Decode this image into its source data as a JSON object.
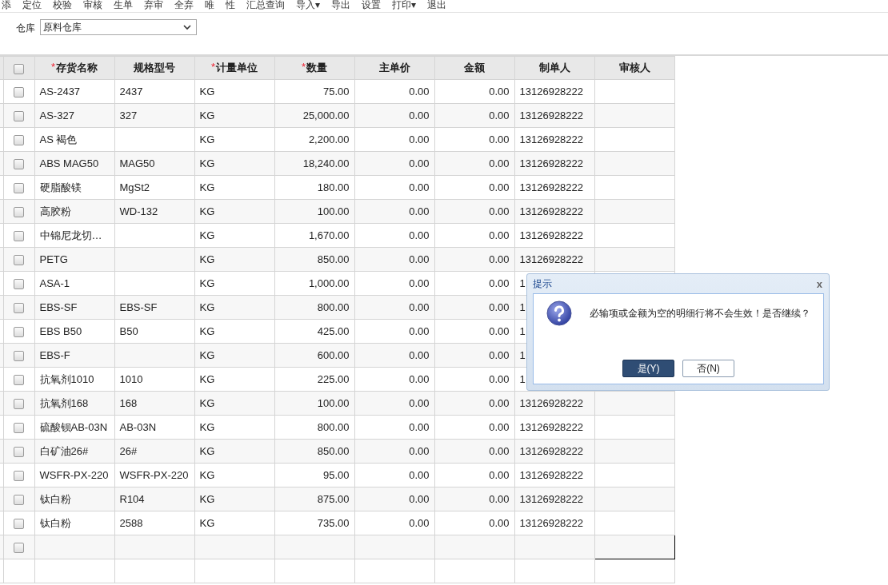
{
  "toolbar": [
    "添",
    "定位",
    "校验",
    "审核",
    "生单",
    "弃审",
    "全弃",
    "唯",
    "性",
    "汇总查询",
    "导入▾",
    "导出",
    "设置",
    "打印▾",
    "退出"
  ],
  "warehouse": {
    "label": "仓库",
    "value": "原料仓库"
  },
  "table": {
    "header_checkbox": {
      "checked": false
    },
    "columns": [
      {
        "label": "存货名称",
        "mark": "*",
        "kind": "text"
      },
      {
        "label": "规格型号",
        "kind": "text"
      },
      {
        "label": "计量单位",
        "mark": "*",
        "kind": "text"
      },
      {
        "label": "数量",
        "mark": "*",
        "kind": "number"
      },
      {
        "label": "主单价",
        "kind": "number"
      },
      {
        "label": "金额",
        "kind": "number"
      },
      {
        "label": "制单人",
        "kind": "text"
      },
      {
        "label": "审核人",
        "kind": "text"
      }
    ],
    "rows": [
      {
        "checked": false,
        "cells": [
          "AS-2437",
          "2437",
          "KG",
          "75.00",
          "0.00",
          "0.00",
          "13126928222",
          ""
        ]
      },
      {
        "checked": false,
        "cells": [
          "AS-327",
          "327",
          "KG",
          "25,000.00",
          "0.00",
          "0.00",
          "13126928222",
          ""
        ]
      },
      {
        "checked": false,
        "cells": [
          "AS 褐色",
          "",
          "KG",
          "2,200.00",
          "0.00",
          "0.00",
          "13126928222",
          ""
        ]
      },
      {
        "checked": false,
        "cells": [
          "ABS MAG50",
          "MAG50",
          "KG",
          "18,240.00",
          "0.00",
          "0.00",
          "13126928222",
          ""
        ]
      },
      {
        "checked": false,
        "cells": [
          "硬脂酸镁",
          "MgSt2",
          "KG",
          "180.00",
          "0.00",
          "0.00",
          "13126928222",
          ""
        ]
      },
      {
        "checked": false,
        "cells": [
          "高胶粉",
          "WD-132",
          "KG",
          "100.00",
          "0.00",
          "0.00",
          "13126928222",
          ""
        ]
      },
      {
        "checked": false,
        "cells": [
          "中锦尼龙切…",
          "",
          "KG",
          "1,670.00",
          "0.00",
          "0.00",
          "13126928222",
          ""
        ]
      },
      {
        "checked": false,
        "cells": [
          "PETG",
          "",
          "KG",
          "850.00",
          "0.00",
          "0.00",
          "13126928222",
          ""
        ]
      },
      {
        "checked": false,
        "cells": [
          "ASA-1",
          "",
          "KG",
          "1,000.00",
          "0.00",
          "0.00",
          "1",
          ""
        ]
      },
      {
        "checked": false,
        "cells": [
          "EBS-SF",
          "EBS-SF",
          "KG",
          "800.00",
          "0.00",
          "0.00",
          "1",
          ""
        ]
      },
      {
        "checked": false,
        "cells": [
          "EBS B50",
          "B50",
          "KG",
          "425.00",
          "0.00",
          "0.00",
          "1",
          ""
        ]
      },
      {
        "checked": false,
        "cells": [
          "EBS-F",
          "",
          "KG",
          "600.00",
          "0.00",
          "0.00",
          "1",
          ""
        ]
      },
      {
        "checked": false,
        "cells": [
          "抗氧剂1010",
          "1010",
          "KG",
          "225.00",
          "0.00",
          "0.00",
          "1",
          ""
        ]
      },
      {
        "checked": false,
        "cells": [
          "抗氧剂168",
          "168",
          "KG",
          "100.00",
          "0.00",
          "0.00",
          "13126928222",
          ""
        ]
      },
      {
        "checked": false,
        "cells": [
          "硫酸钡AB-03N",
          "AB-03N",
          "KG",
          "800.00",
          "0.00",
          "0.00",
          "13126928222",
          ""
        ]
      },
      {
        "checked": false,
        "cells": [
          "白矿油26#",
          "26#",
          "KG",
          "850.00",
          "0.00",
          "0.00",
          "13126928222",
          ""
        ]
      },
      {
        "checked": false,
        "cells": [
          "WSFR-PX-220",
          "WSFR-PX-220",
          "KG",
          "95.00",
          "0.00",
          "0.00",
          "13126928222",
          ""
        ]
      },
      {
        "checked": false,
        "cells": [
          "钛白粉",
          "R104",
          "KG",
          "875.00",
          "0.00",
          "0.00",
          "13126928222",
          ""
        ]
      },
      {
        "checked": false,
        "cells": [
          "钛白粉",
          "2588",
          "KG",
          "735.00",
          "0.00",
          "0.00",
          "13126928222",
          ""
        ]
      }
    ],
    "empty_rows": [
      {
        "checkbox": {
          "checked": false
        },
        "focused_cell": true
      },
      {
        "focused_cell": false
      }
    ]
  },
  "dialog": {
    "title": "提示",
    "close": "x",
    "message": "必输项或金额为空的明细行将不会生效！是否继续？",
    "buttons": [
      {
        "label": "是(Y)",
        "primary": true
      },
      {
        "label": "否(N)",
        "primary": false
      }
    ]
  }
}
